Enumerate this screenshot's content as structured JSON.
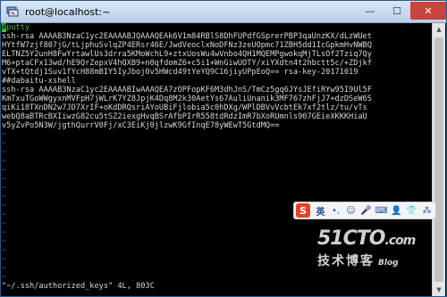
{
  "window": {
    "title": "root@localhost:~",
    "controls": {
      "minimize": "—",
      "maximize": "☐",
      "close": "✕"
    }
  },
  "terminal": {
    "colors": {
      "cursor": "#33cc33",
      "comment": "#4fb43c",
      "tilde": "#3c5af0",
      "text": "#d8d8d8"
    },
    "cursor_char": "#",
    "lines": [
      {
        "text": "putty",
        "style": "green",
        "cursor": true
      },
      {
        "text": "ssh-rsa AAAAB3NzaC1yc2EAAAABJQAAAQEAk6V1m84RBlS8DhFUPdfGSprerPBP3qaUnzKX/dLzWUet",
        "style": ""
      },
      {
        "text": "HYtfW7zjf807jG/tLjphuSvlqZP4ERsr46E/JwdVeoclxNoDFNz3zeUOpmc71ZBH5dd1IcGpkmHvNWBQ",
        "style": ""
      },
      {
        "text": "ELTNZ5Y2unH8FwYrtawlUs3drra5KMoWchL9+ztxUosWu4wVnbo4QH1MQEMPgwokqMjTLsOf2Tziq7Qy",
        "style": ""
      },
      {
        "text": "M6+ptaCFx13wd/hE9QrZepxV4hQXB9+n0qfdomZ6+c5i1+WnGiwUOTY/xiYXdtn4t2hbctt5c/+ZDjkf",
        "style": ""
      },
      {
        "text": "vTX+tQtdj1Suv1fYcH88mBIY5IyJbojOv5HWcd49tYeYQ9C16jiyUPpEoQ== rsa-key-20171019",
        "style": ""
      },
      {
        "text": "##dabaitu-xshell",
        "style": ""
      },
      {
        "text": "ssh-rsa AAAAB3NzaC1yc2EAAAABIwAAAQEA7zOPFopKF6M3dhJnS/TmCz5gq6JYsJEfiRYw95I9Ul5F",
        "style": ""
      },
      {
        "text": "KmTxuTGoWWgyxnMVFpH7jWLrK7YZ8JpjK4Dq8M2k30AetYs67AuliUnanik3MF767zhFjJ7+dzDSeW6S",
        "style": ""
      },
      {
        "text": "qiKi18TXnDN2w7JD7XrIF+oKdDRQsriAYoUBiFjlobia5c0hDXg/WPlDBVvVcbtEk7xf2tlz/tu/vTs",
        "style": ""
      },
      {
        "text": "webQ8aBTRcBXIiwzG82cu5tSZ2iexgHvqBSrAfbPIrR558tdRdzImR7bXoRUmnls907GEieXKKKHiaU",
        "style": ""
      },
      {
        "text": "v5yZvPo5N3W/jgthQurrV0Fj/xC3EiKj0jlzwK9GfInqE78yWEwT5GtdMQ==",
        "style": ""
      },
      {
        "text": "~",
        "style": "tilde"
      },
      {
        "text": "~",
        "style": "tilde"
      },
      {
        "text": "~",
        "style": "tilde"
      },
      {
        "text": "~",
        "style": "tilde"
      },
      {
        "text": "~",
        "style": "tilde"
      },
      {
        "text": "~",
        "style": "tilde"
      },
      {
        "text": "~",
        "style": "tilde"
      },
      {
        "text": "~",
        "style": "tilde"
      },
      {
        "text": "~",
        "style": "tilde"
      },
      {
        "text": "~",
        "style": "tilde"
      },
      {
        "text": "~",
        "style": "tilde"
      },
      {
        "text": "~",
        "style": "tilde"
      },
      {
        "text": "~",
        "style": "tilde"
      },
      {
        "text": "~",
        "style": "tilde"
      },
      {
        "text": "~",
        "style": "tilde"
      },
      {
        "text": "~",
        "style": "tilde"
      },
      {
        "text": "~",
        "style": "tilde"
      },
      {
        "text": "\"~/.ssh/authorized_keys\" 4L, 803C",
        "style": "status"
      }
    ]
  },
  "ime_toolbar": {
    "logo": "S",
    "items": [
      {
        "name": "ime-mode-english",
        "label": "英"
      },
      {
        "name": "ime-punctuation",
        "label": "•,"
      },
      {
        "name": "ime-emoji",
        "label": "☺"
      },
      {
        "name": "ime-voice",
        "label": "🎤"
      },
      {
        "name": "ime-keyboard",
        "label": "⌨"
      },
      {
        "name": "ime-user",
        "label": "👤"
      },
      {
        "name": "ime-shirt",
        "label": "👕"
      },
      {
        "name": "ime-tools",
        "label": "⁂"
      }
    ]
  },
  "watermark": {
    "top_main": "51CTO",
    "top_suffix": ".com",
    "bottom_main": "技术博客",
    "bottom_suffix": "Blog"
  }
}
